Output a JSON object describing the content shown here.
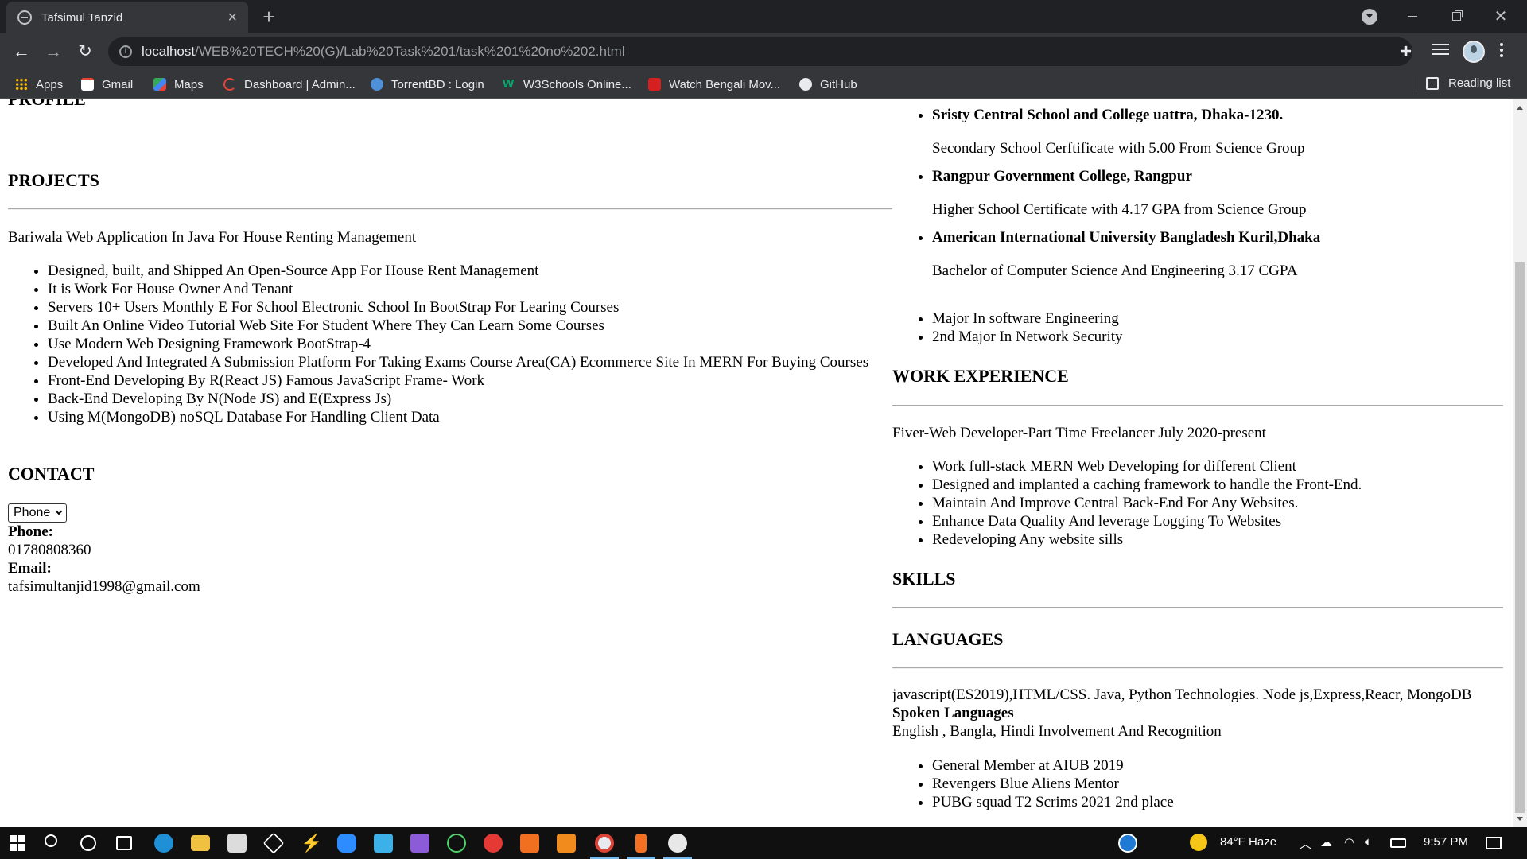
{
  "browser": {
    "tab_title": "Tafsimul Tanzid",
    "tab_close": "×",
    "new_tab": "+",
    "url_host": "localhost",
    "url_path": "/WEB%20TECH%20(G)/Lab%20Task%201/task%201%20no%202.html",
    "bookmarks": [
      "Apps",
      "Gmail",
      "Maps",
      "Dashboard | Admin...",
      "TorrentBD : Login",
      "W3Schools Online...",
      "Watch Bengali Mov...",
      "GitHub"
    ],
    "reading_list": "Reading list"
  },
  "page": {
    "left": {
      "profile_heading": "PROFILE",
      "projects_heading": "PROJECTS",
      "project_title": "Bariwala Web Application In Java For House Renting Management",
      "project_items": [
        "Designed, built, and Shipped An Open-Source App For House Rent Management",
        "It is Work For House Owner And Tenant",
        "Servers 10+ Users Monthly E For School Electronic School In BootStrap For Learing Courses",
        "Built An Online Video Tutorial Web Site For Student Where They Can Learn Some Courses",
        "Use Modern Web Designing Framework BootStrap-4",
        "Developed And Integrated A Submission Platform For Taking Exams Course Area(CA) Ecommerce Site In MERN For Buying Courses",
        "Front-End Developing By R(React JS) Famous JavaScript Frame- Work",
        "Back-End Developing By N(Node JS) and E(Express Js)",
        "Using M(MongoDB) noSQL Database For Handling Client Data"
      ],
      "contact_heading": "CONTACT",
      "contact_select": "Phone",
      "phone_label": "Phone:",
      "phone_value": "01780808360",
      "email_label": "Email:",
      "email_value": "tafsimultanjid1998@gmail.com"
    },
    "right": {
      "education": [
        {
          "school": "Sristy Central School and College uattra, Dhaka-1230.",
          "detail": "Secondary School Cerftificate with 5.00 From Science Group"
        },
        {
          "school": "Rangpur Government College, Rangpur",
          "detail": "Higher School Certificate with 4.17 GPA from Science Group"
        },
        {
          "school": "American International University Bangladesh Kuril,Dhaka",
          "detail": "Bachelor of Computer Science And Engineering 3.17 CGPA"
        }
      ],
      "majors": [
        "Major In software Engineering",
        "2nd Major In Network Security"
      ],
      "work_heading": "WORK EXPERIENCE",
      "work_title": "Fiver-Web Developer-Part Time Freelancer July 2020-present",
      "work_items": [
        "Work full-stack MERN Web Developing for different Client",
        "Designed and implanted a caching framework to handle the Front-End.",
        "Maintain And Improve Central Back-End For Any Websites.",
        "Enhance Data Quality And leverage Logging To Websites",
        "Redeveloping Any website sills"
      ],
      "skills_heading": "SKILLS",
      "languages_heading": "LANGUAGES",
      "languages_text": "javascript(ES2019),HTML/CSS. Java, Python Technologies. Node js,Express,Reacr, MongoDB",
      "spoken_label": "Spoken Languages",
      "spoken_text": "English , Bangla, Hindi Involvement And Recognition",
      "involvement_items": [
        "General Member at AIUB 2019",
        "Revengers Blue Aliens Mentor",
        "PUBG squad T2 Scrims 2021 2nd place"
      ]
    }
  },
  "taskbar": {
    "weather": "84°F  Haze",
    "time": "9:57 PM"
  },
  "colors": {
    "chrome_dark": "#202124",
    "chrome_toolbar": "#35363a",
    "taskbar": "#101010"
  }
}
